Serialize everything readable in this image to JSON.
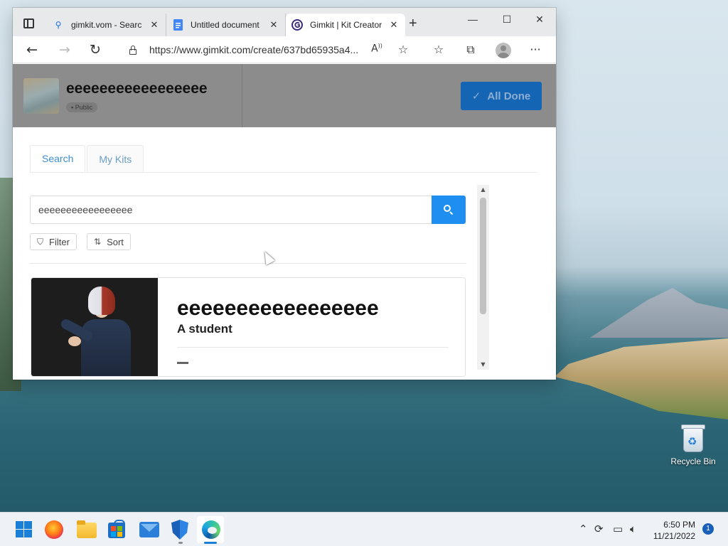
{
  "browser": {
    "tabs": [
      {
        "title": "gimkit.vom - Searc",
        "favicon": "search-icon"
      },
      {
        "title": "Untitled document",
        "favicon": "docs-icon"
      },
      {
        "title": "Gimkit | Kit Creator",
        "favicon": "gimkit-icon"
      }
    ],
    "url": "https://www.gimkit.com/create/637bd65935a4..."
  },
  "kit": {
    "title": "eeeeeeeeeeeeeeeee",
    "visibility": "Public",
    "done_label": "All Done"
  },
  "page_tabs": [
    "Search",
    "My Kits"
  ],
  "search": {
    "value": "eeeeeeeeeeeeeeeee",
    "filter_label": "Filter",
    "sort_label": "Sort"
  },
  "result": {
    "title": "eeeeeeeeeeeeeeeee",
    "subtitle": "A student"
  },
  "desktop": {
    "recycle_bin": "Recycle Bin"
  },
  "taskbar": {
    "time": "6:50 PM",
    "date": "11/21/2022",
    "notifications": "1"
  },
  "colors": {
    "accent": "#1e8ff0",
    "all_done_bg": "#1565b5"
  }
}
